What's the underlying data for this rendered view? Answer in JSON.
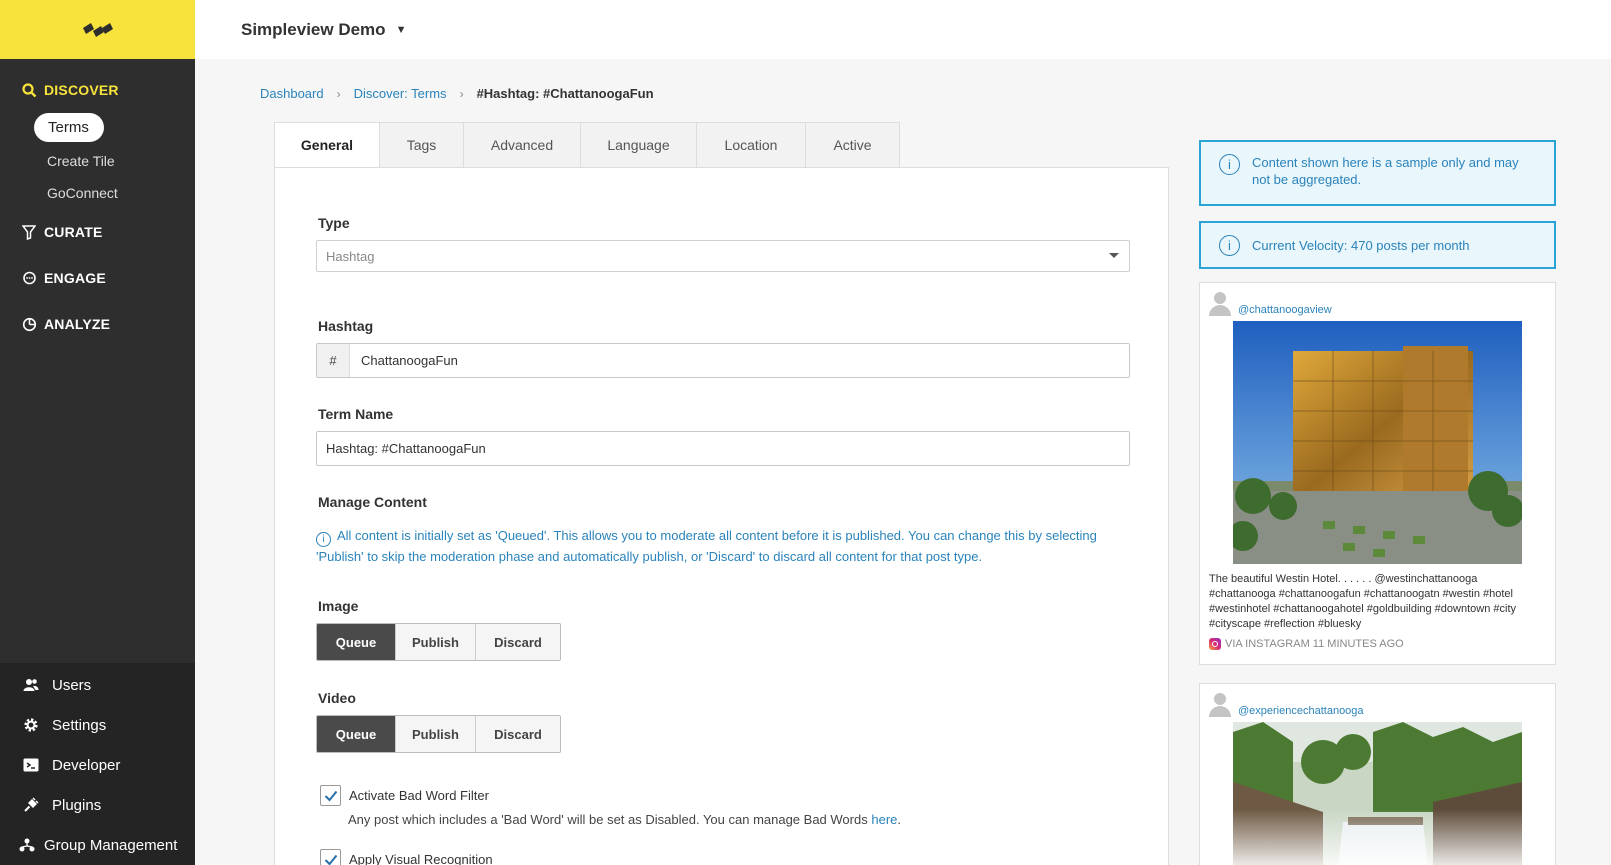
{
  "sidebar": {
    "discover_label": "DISCOVER",
    "discover_items": [
      {
        "label": "Terms"
      },
      {
        "label": "Create Tile"
      },
      {
        "label": "GoConnect"
      }
    ],
    "curate_label": "CURATE",
    "engage_label": "ENGAGE",
    "analyze_label": "ANALYZE",
    "bottom_items": [
      {
        "label": "Users",
        "icon": "users-icon"
      },
      {
        "label": "Settings",
        "icon": "gear-icon"
      },
      {
        "label": "Developer",
        "icon": "developer-icon"
      },
      {
        "label": "Plugins",
        "icon": "plug-icon"
      },
      {
        "label": "Group Management",
        "icon": "group-icon"
      }
    ],
    "accent_color": "#f7e33b"
  },
  "header": {
    "org_name": "Simpleview Demo"
  },
  "breadcrumb": {
    "items": [
      "Dashboard",
      "Discover: Terms"
    ],
    "current": "#Hashtag: #ChattanoogaFun"
  },
  "tabs": [
    "General",
    "Tags",
    "Advanced",
    "Language",
    "Location",
    "Active"
  ],
  "form": {
    "type_label": "Type",
    "type_value": "Hashtag",
    "hashtag_label": "Hashtag",
    "hashtag_prefix": "#",
    "hashtag_value": "ChattanoogaFun",
    "term_name_label": "Term Name",
    "term_name_value": "Hashtag: #ChattanoogaFun",
    "manage_label": "Manage Content",
    "manage_info": "All content is initially set as 'Queued'. This allows you to moderate all content before it is published. You can change this by selecting 'Publish' to skip the moderation phase and automatically publish, or 'Discard' to discard all content for that post type.",
    "image_label": "Image",
    "video_label": "Video",
    "moderation_options": [
      "Queue",
      "Publish",
      "Discard"
    ],
    "image_selected": "Queue",
    "video_selected": "Queue",
    "bad_word_label": "Activate Bad Word Filter",
    "bad_word_desc": "Any post which includes a 'Bad Word' will be set as Disabled. You can manage Bad Words",
    "bad_word_link": "here",
    "bad_word_desc_end": ".",
    "visual_label": "Apply Visual Recognition"
  },
  "notices": {
    "sample": "Content shown here is a sample only and may not be aggregated.",
    "velocity": "Current Velocity: 470 posts per month"
  },
  "posts": [
    {
      "handle": "@chattanoogaview",
      "text": "The beautiful Westin Hotel. . . . . . @westinchattanooga #chattanooga #chattanoogafun #chattanoogatn #westin #hotel #westinhotel #chattanoogahotel #goldbuilding #downtown #city #cityscape #reflection #bluesky",
      "meta": "VIA INSTAGRAM 11 MINUTES AGO"
    },
    {
      "handle": "@experiencechattanooga"
    }
  ]
}
